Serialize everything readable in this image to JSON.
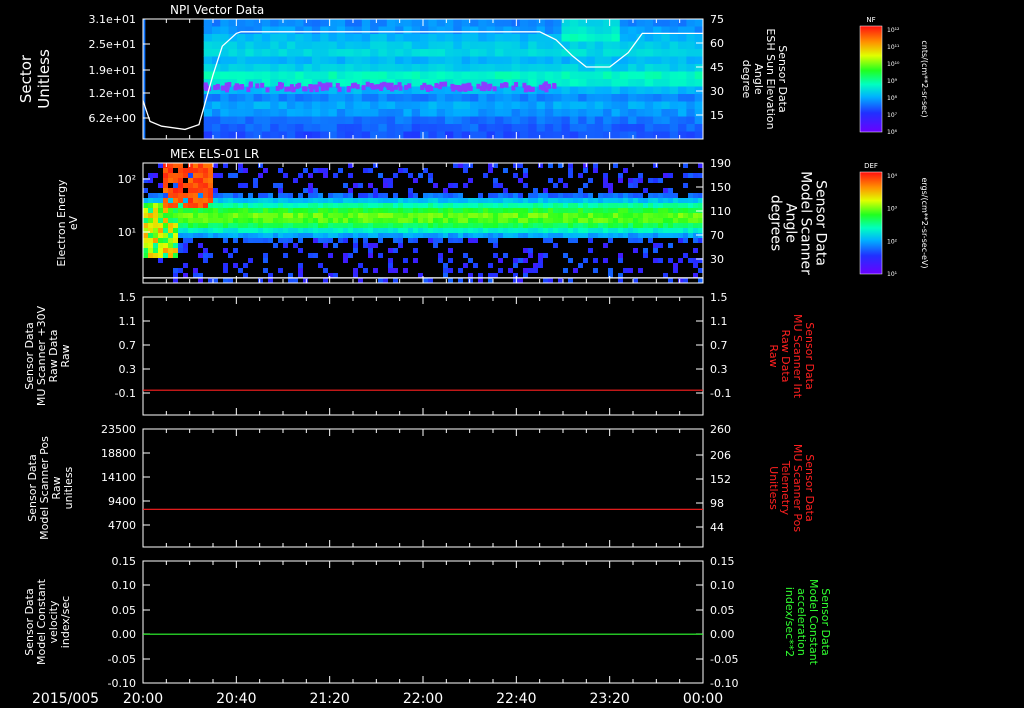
{
  "chart_data": {
    "type": "multi-panel-timeseries",
    "x_axis": {
      "date_label": "2015/005",
      "ticks": [
        "20:00",
        "20:40",
        "21:20",
        "22:00",
        "22:40",
        "23:20",
        "00:00"
      ],
      "range_minutes": [
        0,
        240
      ]
    },
    "panels": [
      {
        "type": "heatmap",
        "title": "NPI Vector Data",
        "ylabel_left": [
          "Sector",
          "Unitless"
        ],
        "yticks_left": [
          "3.1e+01",
          "2.5e+01",
          "1.9e+01",
          "1.2e+01",
          "6.2e+00"
        ],
        "ylabel_right": [
          "Sensor Data",
          "ESH Sun Elevation",
          "Angle",
          "degree"
        ],
        "yticks_right": [
          "75",
          "60",
          "45",
          "30",
          "15"
        ],
        "ylim_right": [
          0,
          75
        ],
        "colorbar": {
          "label": "NF",
          "unit": "cnts/(cm**2-sr-sec)",
          "tick_labels": [
            "10¹²",
            "10¹¹",
            "10¹⁰",
            "10⁹",
            "10⁸",
            "10⁷",
            "10⁶"
          ]
        },
        "overlay_line": {
          "color": "#ffffff",
          "x_minutes": [
            0,
            3,
            8,
            18,
            24,
            30,
            34,
            40,
            42,
            50,
            170,
            177,
            184,
            190,
            200,
            208,
            214,
            240
          ],
          "y": [
            24,
            11,
            8,
            6,
            9,
            40,
            58,
            66,
            67,
            67,
            67,
            62,
            52,
            45,
            45,
            54,
            66,
            66
          ]
        }
      },
      {
        "type": "heatmap",
        "title": "MEx ELS-01 LR",
        "ylabel_left": [
          "Electron Energy",
          "eV"
        ],
        "yticks_left": [
          "10²",
          "10¹"
        ],
        "ylabel_right": [
          "Sensor Data",
          "Model Scanner",
          "Angle",
          "degrees"
        ],
        "yticks_right": [
          "190",
          "150",
          "110",
          "70",
          "30"
        ],
        "ylim_right": [
          0,
          190
        ],
        "colorbar": {
          "label": "DEF",
          "unit": "ergs/(cm**2-sr-sec-eV)",
          "tick_labels": [
            "10⁴",
            "10³",
            "10²",
            "10¹"
          ]
        },
        "overlay_line": {
          "color": "#ffffff",
          "x_minutes": [
            0,
            240
          ],
          "y": [
            8,
            8
          ]
        }
      },
      {
        "type": "line",
        "ylabel_left": [
          "Sensor Data",
          "MU Scanner +30V",
          "Raw Data",
          "Raw"
        ],
        "yticks_left": [
          "1.5",
          "1.1",
          "0.7",
          "0.3",
          "-0.1"
        ],
        "ylim_left": [
          -0.4,
          1.5
        ],
        "ylabel_right": [
          "Sensor Data",
          "MU Scanner Int",
          "Raw Data",
          "Raw"
        ],
        "ylabel_right_color": "#ff2020",
        "yticks_right": [
          "1.5",
          "1.1",
          "0.7",
          "0.3",
          "-0.1"
        ],
        "series": [
          {
            "color": "#ff2020",
            "x_minutes": [
              0,
              240
            ],
            "y": [
              0.0,
              0.0
            ]
          }
        ]
      },
      {
        "type": "line",
        "ylabel_left": [
          "Sensor Data",
          "Model Scanner Pos",
          "Raw",
          "unitless"
        ],
        "yticks_left": [
          "23500",
          "18800",
          "14100",
          "9400",
          "4700"
        ],
        "ylim_left": [
          0,
          23500
        ],
        "ylabel_right": [
          "Sensor Data",
          "MU Scanner Pos",
          "Telemetry",
          "Unitless"
        ],
        "ylabel_right_color": "#ff2020",
        "yticks_right": [
          "260",
          "206",
          "152",
          "98",
          "44"
        ],
        "series": [
          {
            "color": "#ff2020",
            "x_minutes": [
              0,
              240
            ],
            "y": [
              7500,
              7500
            ]
          }
        ]
      },
      {
        "type": "line",
        "ylabel_left": [
          "Sensor Data",
          "Model Constant",
          "velocity",
          "index/sec"
        ],
        "yticks_left": [
          "0.15",
          "0.10",
          "0.05",
          "0.00",
          "-0.05",
          "-0.10"
        ],
        "ylim_left": [
          -0.1,
          0.15
        ],
        "ylabel_right": [
          "Sensor Data",
          "Model Constant",
          "acceleration",
          "index/sec**2"
        ],
        "ylabel_right_color": "#30ff30",
        "yticks_right": [
          "0.15",
          "0.10",
          "0.05",
          "0.00",
          "-0.05",
          "-0.10"
        ],
        "series": [
          {
            "color": "#30ff30",
            "x_minutes": [
              0,
              240
            ],
            "y": [
              0.0,
              0.0
            ]
          }
        ]
      }
    ]
  }
}
